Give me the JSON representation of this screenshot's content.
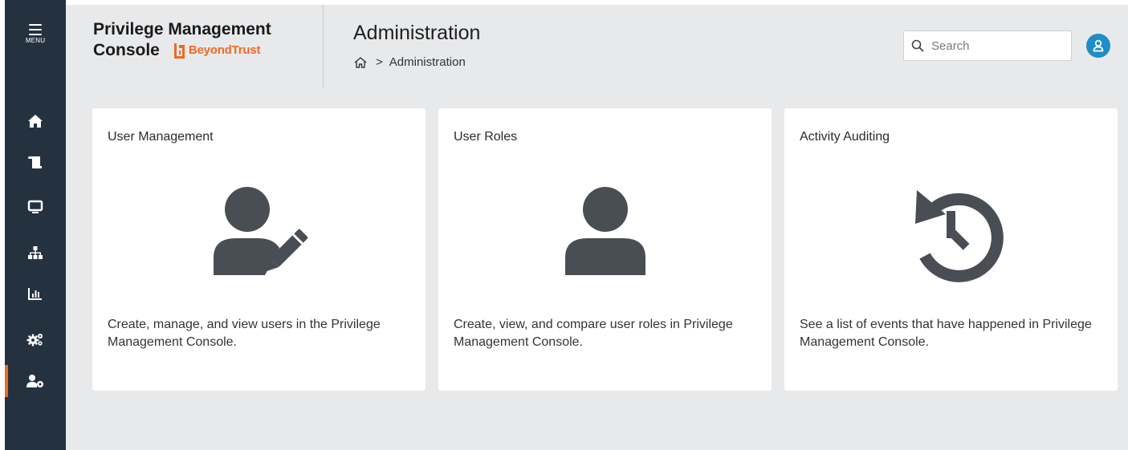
{
  "app": {
    "title_line1": "Privilege Management",
    "title_line2": "Console",
    "brand": "BeyondTrust",
    "accent_color": "#f06a22",
    "sidebar_color": "#243240"
  },
  "sidebar": {
    "menu_label": "MENU",
    "items": [
      {
        "icon": "home-icon",
        "active": false
      },
      {
        "icon": "scroll-icon",
        "active": false
      },
      {
        "icon": "monitor-icon",
        "active": false
      },
      {
        "icon": "hierarchy-icon",
        "active": false
      },
      {
        "icon": "bar-chart-icon",
        "active": false
      },
      {
        "icon": "gears-icon",
        "active": false
      },
      {
        "icon": "user-settings-icon",
        "active": true
      }
    ]
  },
  "header": {
    "page_title": "Administration",
    "breadcrumb": {
      "home_icon": "home-outline-icon",
      "separator": ">",
      "current": "Administration"
    },
    "search": {
      "placeholder": "Search",
      "value": ""
    },
    "avatar_icon": "user-icon",
    "avatar_color": "#1f8dc6"
  },
  "cards": [
    {
      "title": "User Management",
      "icon": "user-edit-icon",
      "description": "Create, manage, and view users in the Privilege Management Console."
    },
    {
      "title": "User Roles",
      "icon": "user-icon",
      "description": "Create, view, and compare user roles in Privilege Management Console."
    },
    {
      "title": "Activity Auditing",
      "icon": "history-icon",
      "description": "See a list of events that have happened in Privilege Management Console."
    }
  ]
}
